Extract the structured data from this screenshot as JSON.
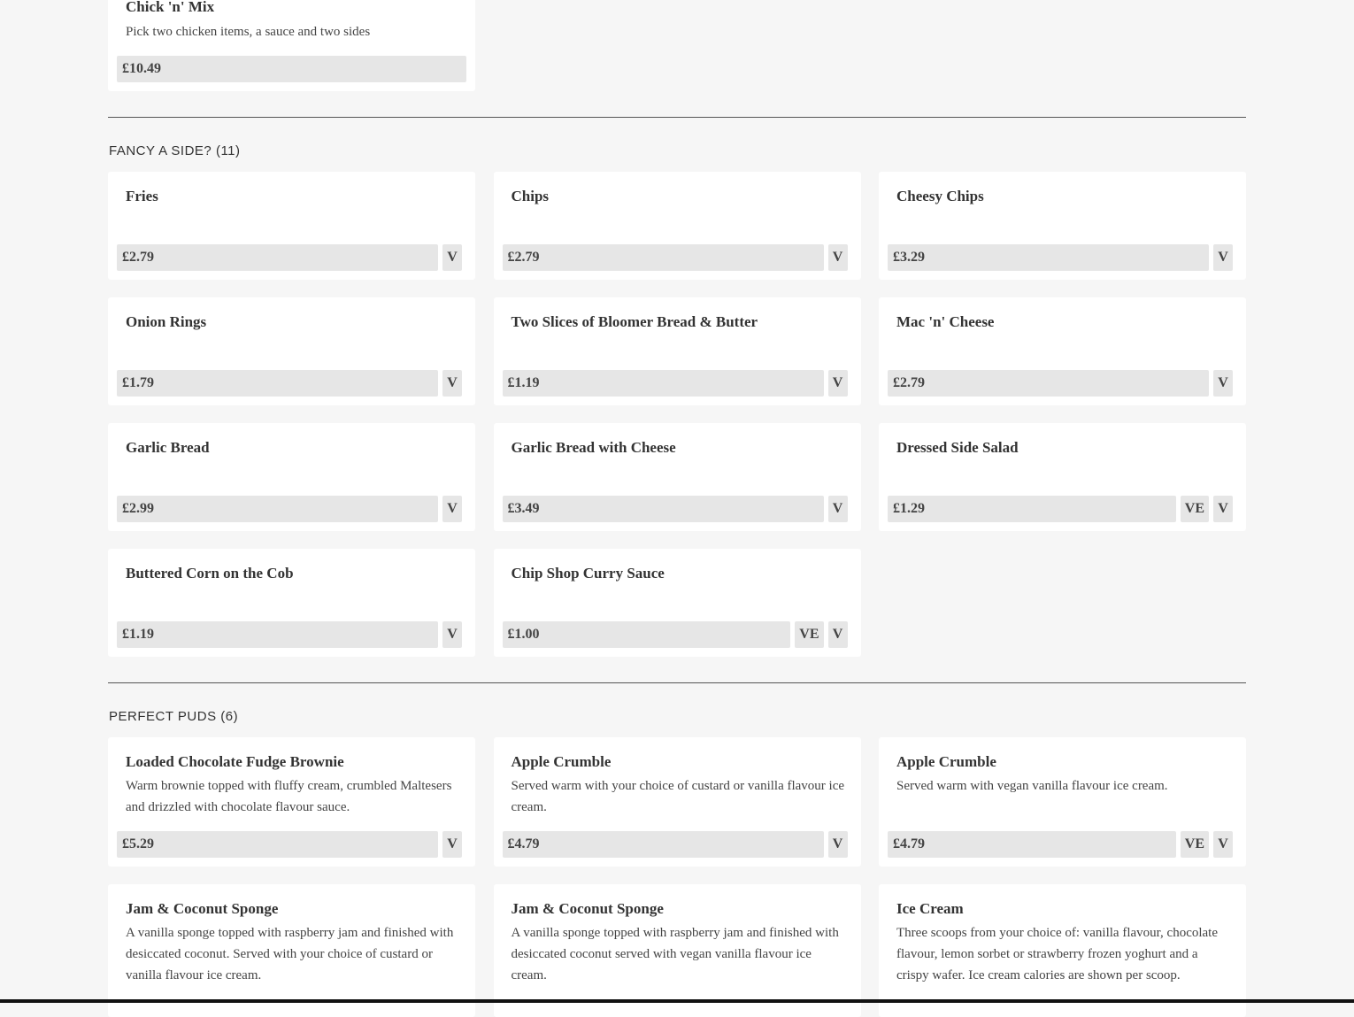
{
  "top_card": {
    "title": "Chick 'n' Mix",
    "desc": "Pick two chicken items, a sauce and two sides",
    "price": "£10.49"
  },
  "sides": {
    "heading": "FANCY A SIDE? (11)",
    "items": [
      {
        "title": "Fries",
        "price": "£2.79",
        "tags": [
          "V"
        ]
      },
      {
        "title": "Chips",
        "price": "£2.79",
        "tags": [
          "V"
        ]
      },
      {
        "title": "Cheesy Chips",
        "price": "£3.29",
        "tags": [
          "V"
        ]
      },
      {
        "title": "Onion Rings",
        "price": "£1.79",
        "tags": [
          "V"
        ]
      },
      {
        "title": "Two Slices of Bloomer Bread & Butter",
        "price": "£1.19",
        "tags": [
          "V"
        ]
      },
      {
        "title": "Mac 'n' Cheese",
        "price": "£2.79",
        "tags": [
          "V"
        ]
      },
      {
        "title": "Garlic Bread",
        "price": "£2.99",
        "tags": [
          "V"
        ]
      },
      {
        "title": "Garlic Bread with Cheese",
        "price": "£3.49",
        "tags": [
          "V"
        ]
      },
      {
        "title": "Dressed Side Salad",
        "price": "£1.29",
        "tags": [
          "VE",
          "V"
        ]
      },
      {
        "title": "Buttered Corn on the Cob",
        "price": "£1.19",
        "tags": [
          "V"
        ]
      },
      {
        "title": "Chip Shop Curry Sauce",
        "price": "£1.00",
        "tags": [
          "VE",
          "V"
        ]
      }
    ]
  },
  "puds": {
    "heading": "PERFECT PUDS (6)",
    "items": [
      {
        "title": "Loaded Chocolate Fudge Brownie",
        "desc": "Warm brownie topped with fluffy cream, crumbled Maltesers and drizzled with chocolate flavour sauce.",
        "price": "£5.29",
        "tags": [
          "V"
        ]
      },
      {
        "title": "Apple Crumble",
        "desc": "Served warm with your choice of custard or vanilla flavour ice cream.",
        "price": "£4.79",
        "tags": [
          "V"
        ]
      },
      {
        "title": "Apple Crumble",
        "desc": "Served warm with vegan vanilla flavour ice cream.",
        "price": "£4.79",
        "tags": [
          "VE",
          "V"
        ]
      },
      {
        "title": "Jam & Coconut Sponge",
        "desc": "A vanilla sponge topped with raspberry jam and finished with desiccated coconut. Served with your choice of custard or vanilla flavour ice cream."
      },
      {
        "title": "Jam & Coconut Sponge",
        "desc": "A vanilla sponge topped with raspberry jam and finished with desiccated coconut served with vegan vanilla flavour ice cream."
      },
      {
        "title": "Ice Cream",
        "desc": "Three scoops from your choice of: vanilla flavour, chocolate flavour, lemon sorbet or strawberry frozen yoghurt and a crispy wafer. Ice cream calories are shown per scoop."
      }
    ]
  }
}
